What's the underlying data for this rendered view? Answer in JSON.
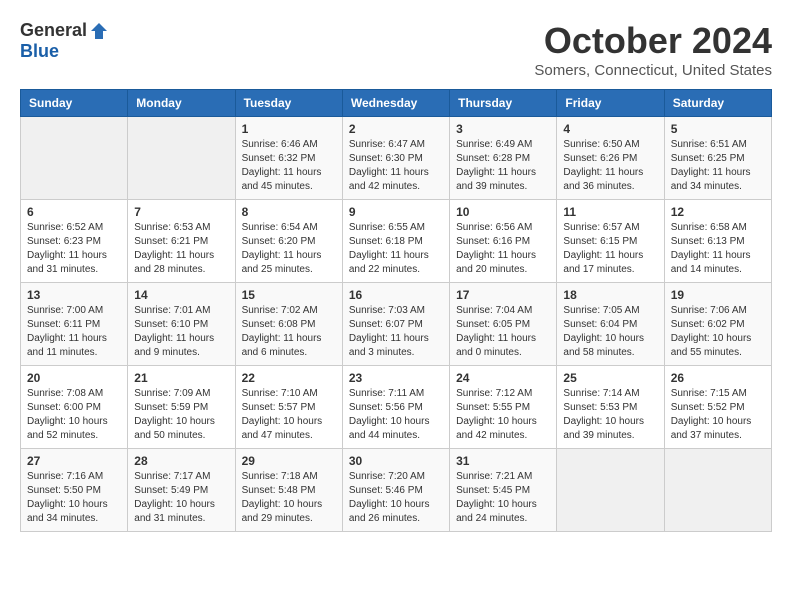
{
  "header": {
    "logo_general": "General",
    "logo_blue": "Blue",
    "month_title": "October 2024",
    "location": "Somers, Connecticut, United States"
  },
  "days_of_week": [
    "Sunday",
    "Monday",
    "Tuesday",
    "Wednesday",
    "Thursday",
    "Friday",
    "Saturday"
  ],
  "weeks": [
    [
      {
        "day": "",
        "empty": true
      },
      {
        "day": "",
        "empty": true
      },
      {
        "day": "1",
        "sunrise": "6:46 AM",
        "sunset": "6:32 PM",
        "daylight": "11 hours and 45 minutes."
      },
      {
        "day": "2",
        "sunrise": "6:47 AM",
        "sunset": "6:30 PM",
        "daylight": "11 hours and 42 minutes."
      },
      {
        "day": "3",
        "sunrise": "6:49 AM",
        "sunset": "6:28 PM",
        "daylight": "11 hours and 39 minutes."
      },
      {
        "day": "4",
        "sunrise": "6:50 AM",
        "sunset": "6:26 PM",
        "daylight": "11 hours and 36 minutes."
      },
      {
        "day": "5",
        "sunrise": "6:51 AM",
        "sunset": "6:25 PM",
        "daylight": "11 hours and 34 minutes."
      }
    ],
    [
      {
        "day": "6",
        "sunrise": "6:52 AM",
        "sunset": "6:23 PM",
        "daylight": "11 hours and 31 minutes."
      },
      {
        "day": "7",
        "sunrise": "6:53 AM",
        "sunset": "6:21 PM",
        "daylight": "11 hours and 28 minutes."
      },
      {
        "day": "8",
        "sunrise": "6:54 AM",
        "sunset": "6:20 PM",
        "daylight": "11 hours and 25 minutes."
      },
      {
        "day": "9",
        "sunrise": "6:55 AM",
        "sunset": "6:18 PM",
        "daylight": "11 hours and 22 minutes."
      },
      {
        "day": "10",
        "sunrise": "6:56 AM",
        "sunset": "6:16 PM",
        "daylight": "11 hours and 20 minutes."
      },
      {
        "day": "11",
        "sunrise": "6:57 AM",
        "sunset": "6:15 PM",
        "daylight": "11 hours and 17 minutes."
      },
      {
        "day": "12",
        "sunrise": "6:58 AM",
        "sunset": "6:13 PM",
        "daylight": "11 hours and 14 minutes."
      }
    ],
    [
      {
        "day": "13",
        "sunrise": "7:00 AM",
        "sunset": "6:11 PM",
        "daylight": "11 hours and 11 minutes."
      },
      {
        "day": "14",
        "sunrise": "7:01 AM",
        "sunset": "6:10 PM",
        "daylight": "11 hours and 9 minutes."
      },
      {
        "day": "15",
        "sunrise": "7:02 AM",
        "sunset": "6:08 PM",
        "daylight": "11 hours and 6 minutes."
      },
      {
        "day": "16",
        "sunrise": "7:03 AM",
        "sunset": "6:07 PM",
        "daylight": "11 hours and 3 minutes."
      },
      {
        "day": "17",
        "sunrise": "7:04 AM",
        "sunset": "6:05 PM",
        "daylight": "11 hours and 0 minutes."
      },
      {
        "day": "18",
        "sunrise": "7:05 AM",
        "sunset": "6:04 PM",
        "daylight": "10 hours and 58 minutes."
      },
      {
        "day": "19",
        "sunrise": "7:06 AM",
        "sunset": "6:02 PM",
        "daylight": "10 hours and 55 minutes."
      }
    ],
    [
      {
        "day": "20",
        "sunrise": "7:08 AM",
        "sunset": "6:00 PM",
        "daylight": "10 hours and 52 minutes."
      },
      {
        "day": "21",
        "sunrise": "7:09 AM",
        "sunset": "5:59 PM",
        "daylight": "10 hours and 50 minutes."
      },
      {
        "day": "22",
        "sunrise": "7:10 AM",
        "sunset": "5:57 PM",
        "daylight": "10 hours and 47 minutes."
      },
      {
        "day": "23",
        "sunrise": "7:11 AM",
        "sunset": "5:56 PM",
        "daylight": "10 hours and 44 minutes."
      },
      {
        "day": "24",
        "sunrise": "7:12 AM",
        "sunset": "5:55 PM",
        "daylight": "10 hours and 42 minutes."
      },
      {
        "day": "25",
        "sunrise": "7:14 AM",
        "sunset": "5:53 PM",
        "daylight": "10 hours and 39 minutes."
      },
      {
        "day": "26",
        "sunrise": "7:15 AM",
        "sunset": "5:52 PM",
        "daylight": "10 hours and 37 minutes."
      }
    ],
    [
      {
        "day": "27",
        "sunrise": "7:16 AM",
        "sunset": "5:50 PM",
        "daylight": "10 hours and 34 minutes."
      },
      {
        "day": "28",
        "sunrise": "7:17 AM",
        "sunset": "5:49 PM",
        "daylight": "10 hours and 31 minutes."
      },
      {
        "day": "29",
        "sunrise": "7:18 AM",
        "sunset": "5:48 PM",
        "daylight": "10 hours and 29 minutes."
      },
      {
        "day": "30",
        "sunrise": "7:20 AM",
        "sunset": "5:46 PM",
        "daylight": "10 hours and 26 minutes."
      },
      {
        "day": "31",
        "sunrise": "7:21 AM",
        "sunset": "5:45 PM",
        "daylight": "10 hours and 24 minutes."
      },
      {
        "day": "",
        "empty": true
      },
      {
        "day": "",
        "empty": true
      }
    ]
  ],
  "labels": {
    "sunrise": "Sunrise:",
    "sunset": "Sunset:",
    "daylight": "Daylight:"
  }
}
